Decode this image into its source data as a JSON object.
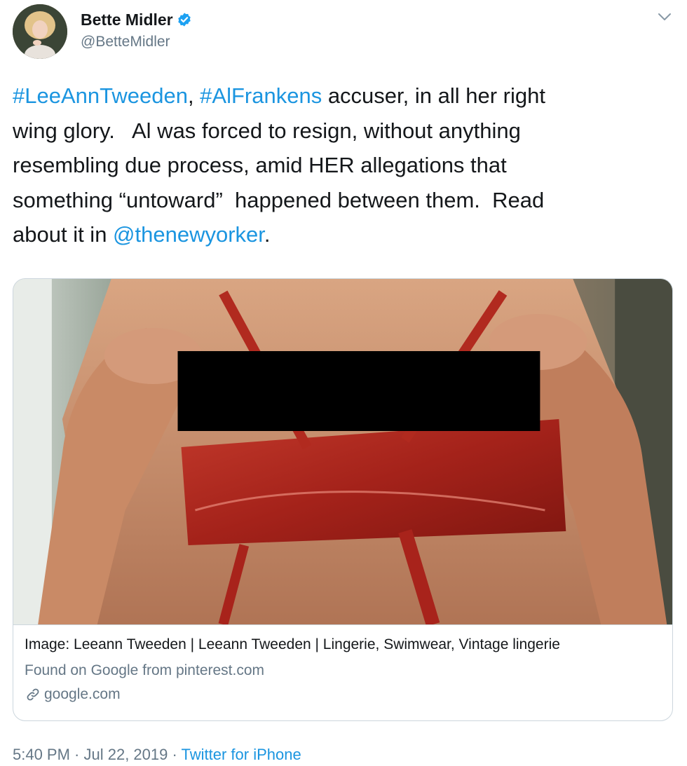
{
  "user": {
    "display_name": "Bette Midler",
    "handle": "@BetteMidler",
    "verified": true
  },
  "tweet": {
    "segments": [
      {
        "text": "#LeeAnnTweeden",
        "link": true
      },
      {
        "text": ", ",
        "link": false
      },
      {
        "text": "#AlFrankens",
        "link": true
      },
      {
        "text": " accuser, in all her right\nwing glory.   Al was forced to resign, without anything\nresembling due process, amid HER allegations that\nsomething “untoward”  happened between them.  Read\nabout it in ",
        "link": false
      },
      {
        "text": "@thenewyorker",
        "link": true
      },
      {
        "text": ".",
        "link": false
      }
    ]
  },
  "card": {
    "title": "Image: Leeann Tweeden | Leeann Tweeden | Lingerie, Swimwear, Vintage lingerie",
    "description": "Found on Google from pinterest.com",
    "domain": "google.com",
    "link_icon": "link-icon"
  },
  "meta": {
    "time": "5:40 PM",
    "separator": " · ",
    "date": "Jul 22, 2019",
    "source": "Twitter for iPhone"
  },
  "icons": {
    "verified": "verified-badge-icon",
    "caret": "chevron-down-icon"
  },
  "colors": {
    "link": "#1b95e0",
    "secondary_text": "#657786",
    "border": "#ccd6dd",
    "verified": "#1da1f2"
  }
}
